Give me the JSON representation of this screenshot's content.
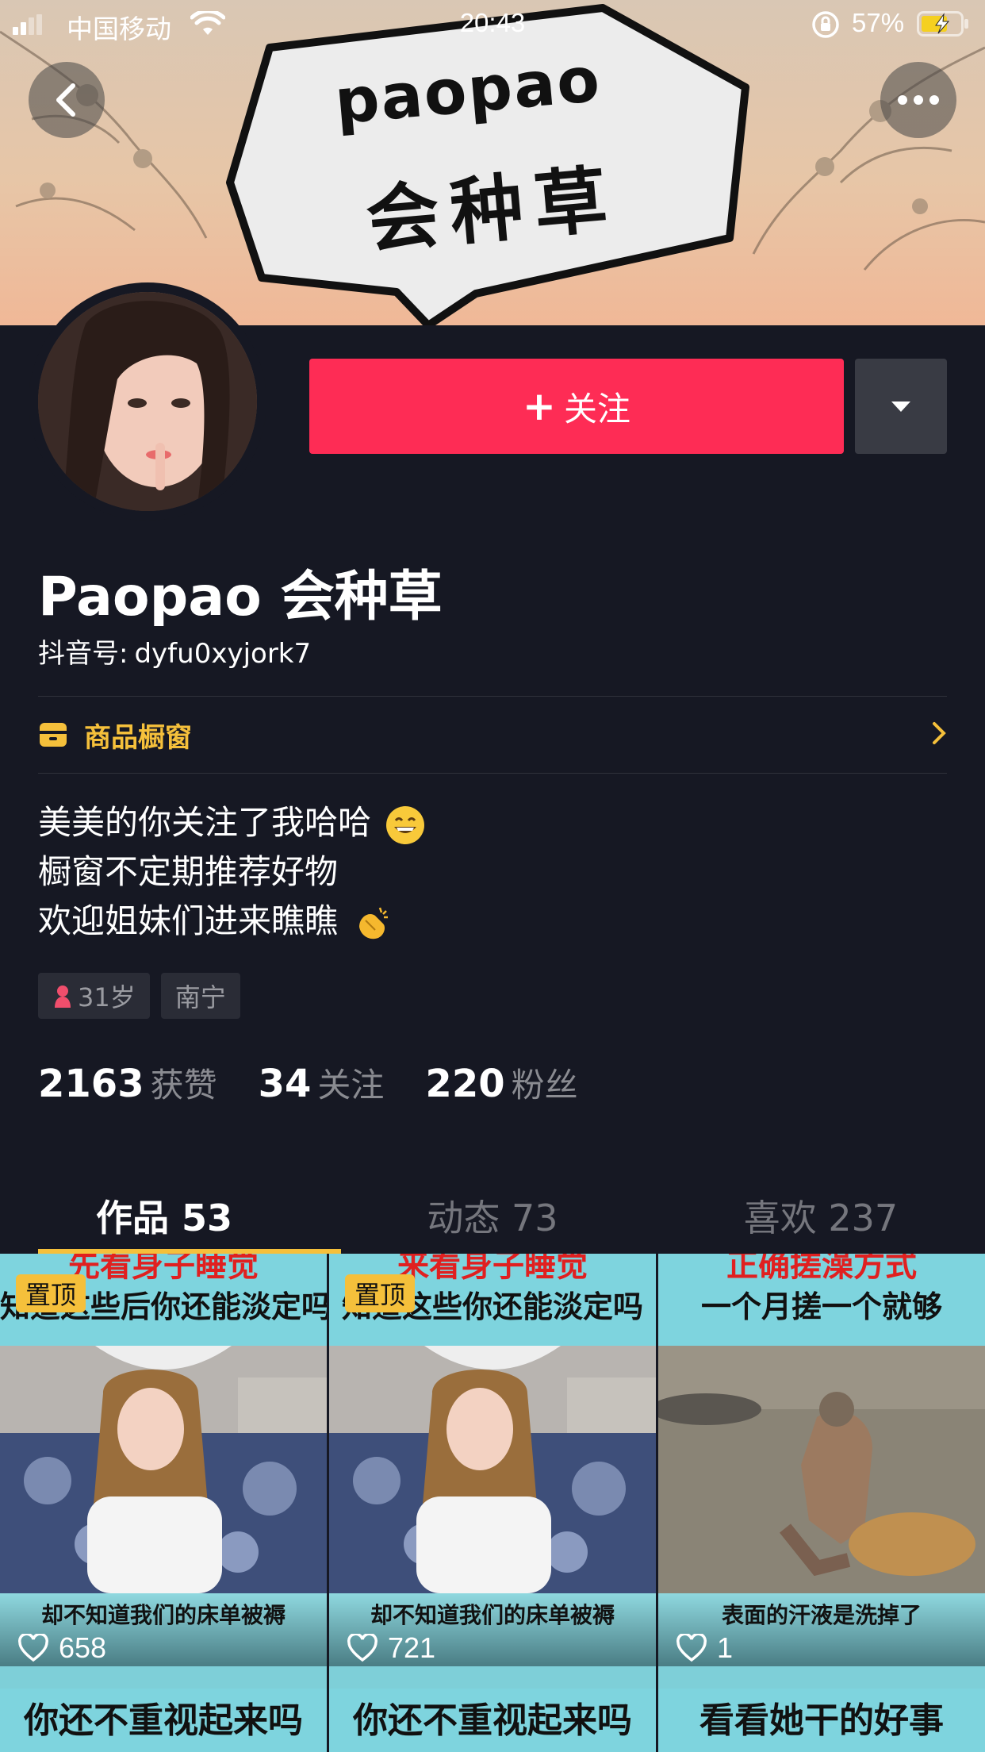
{
  "status_bar": {
    "carrier": "中国移动",
    "time": "20:43",
    "battery_percent": "57%"
  },
  "banner": {
    "line1": "paopao",
    "line2": "会种草"
  },
  "profile": {
    "follow_label": "关注",
    "name": "Paopao 会种草",
    "id_label": "抖音号:",
    "id_value": "dyfu0xyjork7",
    "shop_label": "商品橱窗",
    "bio": [
      "美美的你关注了我哈哈",
      "橱窗不定期推荐好物",
      "欢迎姐妹们进来瞧瞧"
    ],
    "tags": [
      {
        "label": "31岁",
        "icon": "female-icon"
      },
      {
        "label": "南宁"
      }
    ],
    "stats": [
      {
        "num": "2163",
        "label": "获赞"
      },
      {
        "num": "34",
        "label": "关注"
      },
      {
        "num": "220",
        "label": "粉丝"
      }
    ]
  },
  "tabs": [
    {
      "label": "作品 53",
      "active": true
    },
    {
      "label": "动态 73",
      "active": false
    },
    {
      "label": "喜欢 237",
      "active": false
    }
  ],
  "videos": [
    {
      "pinned": true,
      "pin_label": "置顶",
      "caption_top": "先看身子睡觉",
      "caption_sub": "知道这些后你还能淡定吗",
      "caption_mid": "却不知道我们的床单被褥",
      "caption_bottom": "你还不重视起来吗",
      "likes": "658"
    },
    {
      "pinned": true,
      "pin_label": "置顶",
      "caption_top": "来看身子睡觉",
      "caption_sub": "知道这些你还能淡定吗",
      "caption_mid": "却不知道我们的床单被褥",
      "caption_bottom": "你还不重视起来吗",
      "likes": "721"
    },
    {
      "pinned": false,
      "caption_top": "正确搓澡方式",
      "caption_sub": "一个月搓一个就够",
      "caption_mid": "表面的汗液是洗掉了",
      "caption_bottom": "看看她干的好事",
      "likes": "1"
    }
  ],
  "colors": {
    "background": "#161823",
    "follow_button": "#fe2c55",
    "accent_yellow": "#f5c03b"
  }
}
